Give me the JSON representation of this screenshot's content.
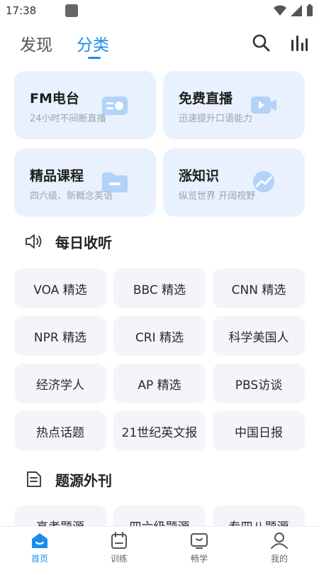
{
  "status_bar": {
    "time": "17:38"
  },
  "header": {
    "tabs": [
      {
        "label": "发现",
        "active": false
      },
      {
        "label": "分类",
        "active": true
      }
    ]
  },
  "cards": [
    {
      "title": "FM电台",
      "subtitle": "24小时不间断直播",
      "icon": "radio-icon"
    },
    {
      "title": "免费直播",
      "subtitle": "迅速提升口语能力",
      "icon": "video-icon"
    },
    {
      "title": "精品课程",
      "subtitle": "四六级、新概念英语",
      "icon": "folder-icon"
    },
    {
      "title": "涨知识",
      "subtitle": "纵览世界 开阔视野",
      "icon": "trend-icon"
    }
  ],
  "daily_listening": {
    "title": "每日收听",
    "items": [
      "VOA 精选",
      "BBC 精选",
      "CNN 精选",
      "NPR 精选",
      "CRI 精选",
      "科学美国人",
      "经济学人",
      "AP 精选",
      "PBS访谈",
      "热点话题",
      "21世纪英文报",
      "中国日报"
    ]
  },
  "question_source": {
    "title": "题源外刊",
    "items": [
      "高考题源",
      "四六级题源",
      "专四八题源"
    ]
  },
  "bottom_nav": [
    {
      "label": "首页",
      "icon": "home-icon",
      "active": true
    },
    {
      "label": "训练",
      "icon": "training-icon",
      "active": false
    },
    {
      "label": "畅学",
      "icon": "learn-icon",
      "active": false
    },
    {
      "label": "我的",
      "icon": "profile-icon",
      "active": false
    }
  ],
  "colors": {
    "accent": "#1a8cf0",
    "card_bg": "#e8f1fd",
    "chip_bg": "#f3f5f8"
  }
}
